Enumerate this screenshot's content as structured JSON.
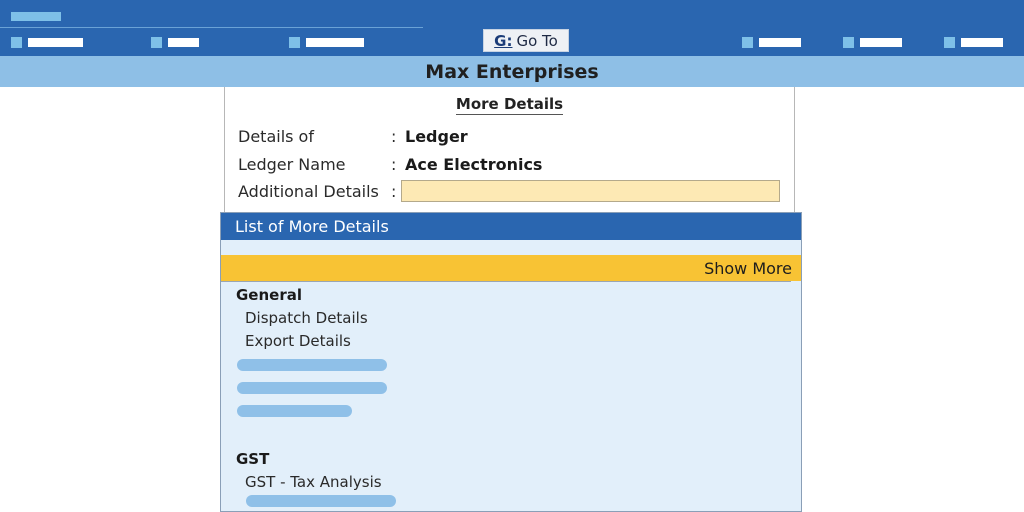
{
  "toolbar": {
    "goto_key": "G:",
    "goto_label": "Go To"
  },
  "company": {
    "name": "Max Enterprises"
  },
  "panel": {
    "title": "More Details",
    "details_of_label": "Details of",
    "details_of_value": "Ledger",
    "ledger_name_label": "Ledger Name",
    "ledger_name_value": "Ace Electronics",
    "additional_details_label": "Additional Details",
    "additional_details_value": "",
    "colon": ":"
  },
  "list": {
    "header": "List of More Details",
    "show_more": "Show More",
    "groups": [
      {
        "title": "General",
        "items": [
          "Dispatch Details",
          "Export Details"
        ]
      },
      {
        "title": "GST",
        "items": [
          "GST - Tax Analysis"
        ]
      }
    ]
  },
  "colors": {
    "topbar": "#2a66b0",
    "company_bar": "#8ebfe6",
    "input_fill": "#fde9b4",
    "show_more_bar": "#f8c334",
    "list_bg": "#e2effa"
  }
}
